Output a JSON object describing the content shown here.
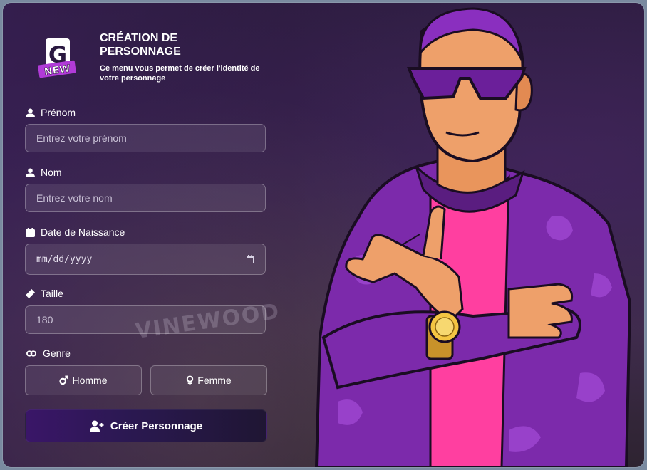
{
  "header": {
    "logo_text": "G",
    "logo_badge": "NEW",
    "title": "CRÉATION DE PERSONNAGE",
    "subtitle": "Ce menu vous permet de créer l'identité de votre personnage"
  },
  "form": {
    "firstname": {
      "label": "Prénom",
      "placeholder": "Entrez votre prénom",
      "icon": "user-icon"
    },
    "lastname": {
      "label": "Nom",
      "placeholder": "Entrez votre nom",
      "icon": "user-icon"
    },
    "birthdate": {
      "label": "Date de Naissance",
      "placeholder": "mm/dd/yyyy",
      "icon": "calendar-icon"
    },
    "height": {
      "label": "Taille",
      "value": "180",
      "icon": "ruler-icon"
    },
    "gender": {
      "label": "Genre",
      "icon": "genderless-icon",
      "options": [
        {
          "label": "Homme",
          "icon": "mars-icon"
        },
        {
          "label": "Femme",
          "icon": "venus-icon"
        }
      ]
    },
    "submit_label": "Créer Personnage"
  },
  "background": {
    "sign_text": "VINEWOOD"
  },
  "colors": {
    "accent": "#3a1668",
    "jacket": "#8a2fbf",
    "shirt": "#ff3fa0",
    "panel": "#2b1d3e"
  }
}
